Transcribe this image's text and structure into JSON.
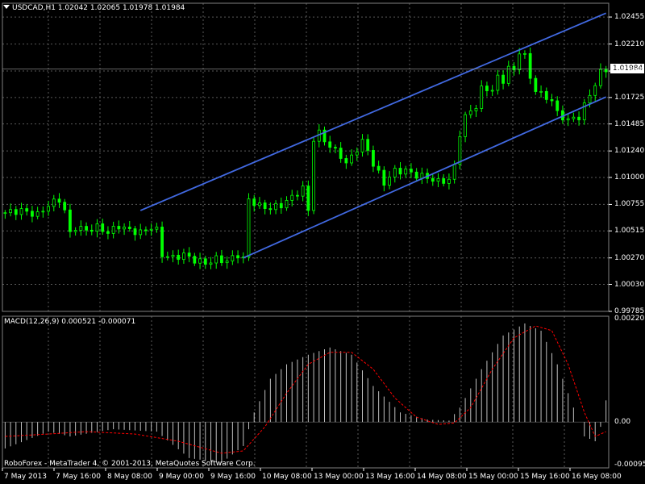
{
  "header": {
    "symbol_info": "USDCAD,H1  1.02042 1.02065 1.01978 1.01984"
  },
  "current_price": "1.01984",
  "indicator": {
    "label": "MACD(12,26,9) 0.000521 -0.000071"
  },
  "footer": {
    "copyright": "RoboForex - MetaTrader 4, © 2001-2013, MetaQuotes Software Corp."
  },
  "colors": {
    "background": "#000000",
    "grid": "#5a5a5a",
    "candles": "#00ff00",
    "channel": "#4169e1",
    "macd_bars": "#c0c0c0",
    "signal": "#ff0000"
  },
  "chart_data": [
    {
      "type": "candlestick",
      "title": "USDCAD,H1",
      "ylim": [
        0.99785,
        1.0258
      ],
      "y_ticks": [
        "1.02455",
        "1.02210",
        "1.01965",
        "1.01725",
        "1.01485",
        "1.01240",
        "1.01000",
        "1.00755",
        "1.00515",
        "1.00270",
        "1.00030",
        "0.99785"
      ],
      "x_ticks": [
        "7 May 2013",
        "7 May 16:00",
        "8 May 08:00",
        "9 May 00:00",
        "9 May 16:00",
        "10 May 08:00",
        "13 May 00:00",
        "13 May 16:00",
        "14 May 08:00",
        "15 May 00:00",
        "15 May 16:00",
        "16 May 08:00"
      ],
      "close_path": [
        [
          0,
          1.0068
        ],
        [
          3,
          1.007
        ],
        [
          6,
          1.0066
        ],
        [
          8,
          1.0075
        ],
        [
          10,
          1.008
        ],
        [
          11,
          1.007
        ],
        [
          12,
          1.0049
        ],
        [
          13,
          1.0055
        ],
        [
          15,
          1.0052
        ],
        [
          17,
          1.0055
        ],
        [
          19,
          1.005
        ],
        [
          21,
          1.0056
        ],
        [
          23,
          1.0052
        ],
        [
          25,
          1.005
        ],
        [
          27,
          1.0055
        ],
        [
          28,
          1.0052
        ],
        [
          29,
          1.003
        ],
        [
          31,
          1.0027
        ],
        [
          33,
          1.003
        ],
        [
          35,
          1.0025
        ],
        [
          37,
          1.0022
        ],
        [
          39,
          1.0026
        ],
        [
          41,
          1.0024
        ],
        [
          43,
          1.003
        ],
        [
          44,
          1.0026
        ],
        [
          45,
          1.008
        ],
        [
          47,
          1.0074
        ],
        [
          49,
          1.0072
        ],
        [
          51,
          1.0075
        ],
        [
          53,
          1.0082
        ],
        [
          55,
          1.009
        ],
        [
          56,
          1.007
        ],
        [
          57,
          1.0135
        ],
        [
          58,
          1.014
        ],
        [
          60,
          1.0128
        ],
        [
          62,
          1.012
        ],
        [
          63,
          1.0112
        ],
        [
          65,
          1.0126
        ],
        [
          66,
          1.0132
        ],
        [
          67,
          1.0125
        ],
        [
          68,
          1.0112
        ],
        [
          70,
          1.0095
        ],
        [
          72,
          1.0106
        ],
        [
          74,
          1.0106
        ],
        [
          76,
          1.0102
        ],
        [
          78,
          1.01
        ],
        [
          80,
          1.0096
        ],
        [
          82,
          1.0098
        ],
        [
          83,
          1.011
        ],
        [
          84,
          1.014
        ],
        [
          85,
          1.0155
        ],
        [
          87,
          1.0165
        ],
        [
          88,
          1.018
        ],
        [
          90,
          1.018
        ],
        [
          91,
          1.019
        ],
        [
          92,
          1.0188
        ],
        [
          93,
          1.02
        ],
        [
          94,
          1.0196
        ],
        [
          95,
          1.0215
        ],
        [
          96,
          1.021
        ],
        [
          97,
          1.019
        ],
        [
          98,
          1.018
        ],
        [
          99,
          1.0175
        ],
        [
          101,
          1.017
        ],
        [
          102,
          1.0158
        ],
        [
          104,
          1.0152
        ],
        [
          106,
          1.0155
        ],
        [
          107,
          1.0165
        ],
        [
          108,
          1.0175
        ],
        [
          109,
          1.0185
        ],
        [
          110,
          1.0195
        ],
        [
          111,
          1.0198
        ]
      ],
      "channel_upper": [
        [
          25,
          1.007
        ],
        [
          111,
          1.0249
        ]
      ],
      "channel_lower": [
        [
          44,
          1.0027
        ],
        [
          111,
          1.0173
        ]
      ]
    },
    {
      "type": "histogram",
      "title": "MACD(12,26,9)",
      "ylim": [
        -0.000954,
        0.002201
      ],
      "y_ticks": [
        "0.002201",
        "0.00",
        "-0.000954"
      ],
      "series": [
        {
          "name": "MACD",
          "path": [
            [
              0,
              -0.00055
            ],
            [
              8,
              -0.0002
            ],
            [
              12,
              -0.0003
            ],
            [
              20,
              -0.00015
            ],
            [
              28,
              -0.0002
            ],
            [
              34,
              -0.00075
            ],
            [
              40,
              -0.00085
            ],
            [
              44,
              -0.0005
            ],
            [
              46,
              0.0002
            ],
            [
              49,
              0.0009
            ],
            [
              52,
              0.0012
            ],
            [
              56,
              0.0014
            ],
            [
              60,
              0.00155
            ],
            [
              64,
              0.0014
            ],
            [
              68,
              0.00075
            ],
            [
              73,
              0.0002
            ],
            [
              78,
              5e-05
            ],
            [
              82,
              3e-05
            ],
            [
              84,
              0.0003
            ],
            [
              88,
              0.0011
            ],
            [
              92,
              0.0018
            ],
            [
              96,
              0.00205
            ],
            [
              99,
              0.0019
            ],
            [
              102,
              0.0012
            ],
            [
              105,
              0.0003
            ],
            [
              107,
              -0.0003
            ],
            [
              109,
              -0.0004
            ],
            [
              110,
              -0.0001
            ],
            [
              111,
              0.00045
            ]
          ]
        },
        {
          "name": "Signal",
          "path": [
            [
              0,
              -0.0003
            ],
            [
              8,
              -0.00025
            ],
            [
              15,
              -0.0002
            ],
            [
              24,
              -0.00025
            ],
            [
              32,
              -0.0004
            ],
            [
              40,
              -0.00065
            ],
            [
              44,
              -0.0006
            ],
            [
              48,
              -0.0001
            ],
            [
              52,
              0.0006
            ],
            [
              56,
              0.0012
            ],
            [
              60,
              0.00145
            ],
            [
              64,
              0.00145
            ],
            [
              68,
              0.0011
            ],
            [
              72,
              0.0005
            ],
            [
              76,
              0.0001
            ],
            [
              80,
              -5e-05
            ],
            [
              83,
              -2e-05
            ],
            [
              86,
              0.0003
            ],
            [
              90,
              0.0011
            ],
            [
              94,
              0.00175
            ],
            [
              98,
              0.002
            ],
            [
              101,
              0.0019
            ],
            [
              104,
              0.0012
            ],
            [
              107,
              0.0002
            ],
            [
              109,
              -0.0003
            ],
            [
              111,
              -0.0002
            ]
          ]
        }
      ]
    }
  ]
}
